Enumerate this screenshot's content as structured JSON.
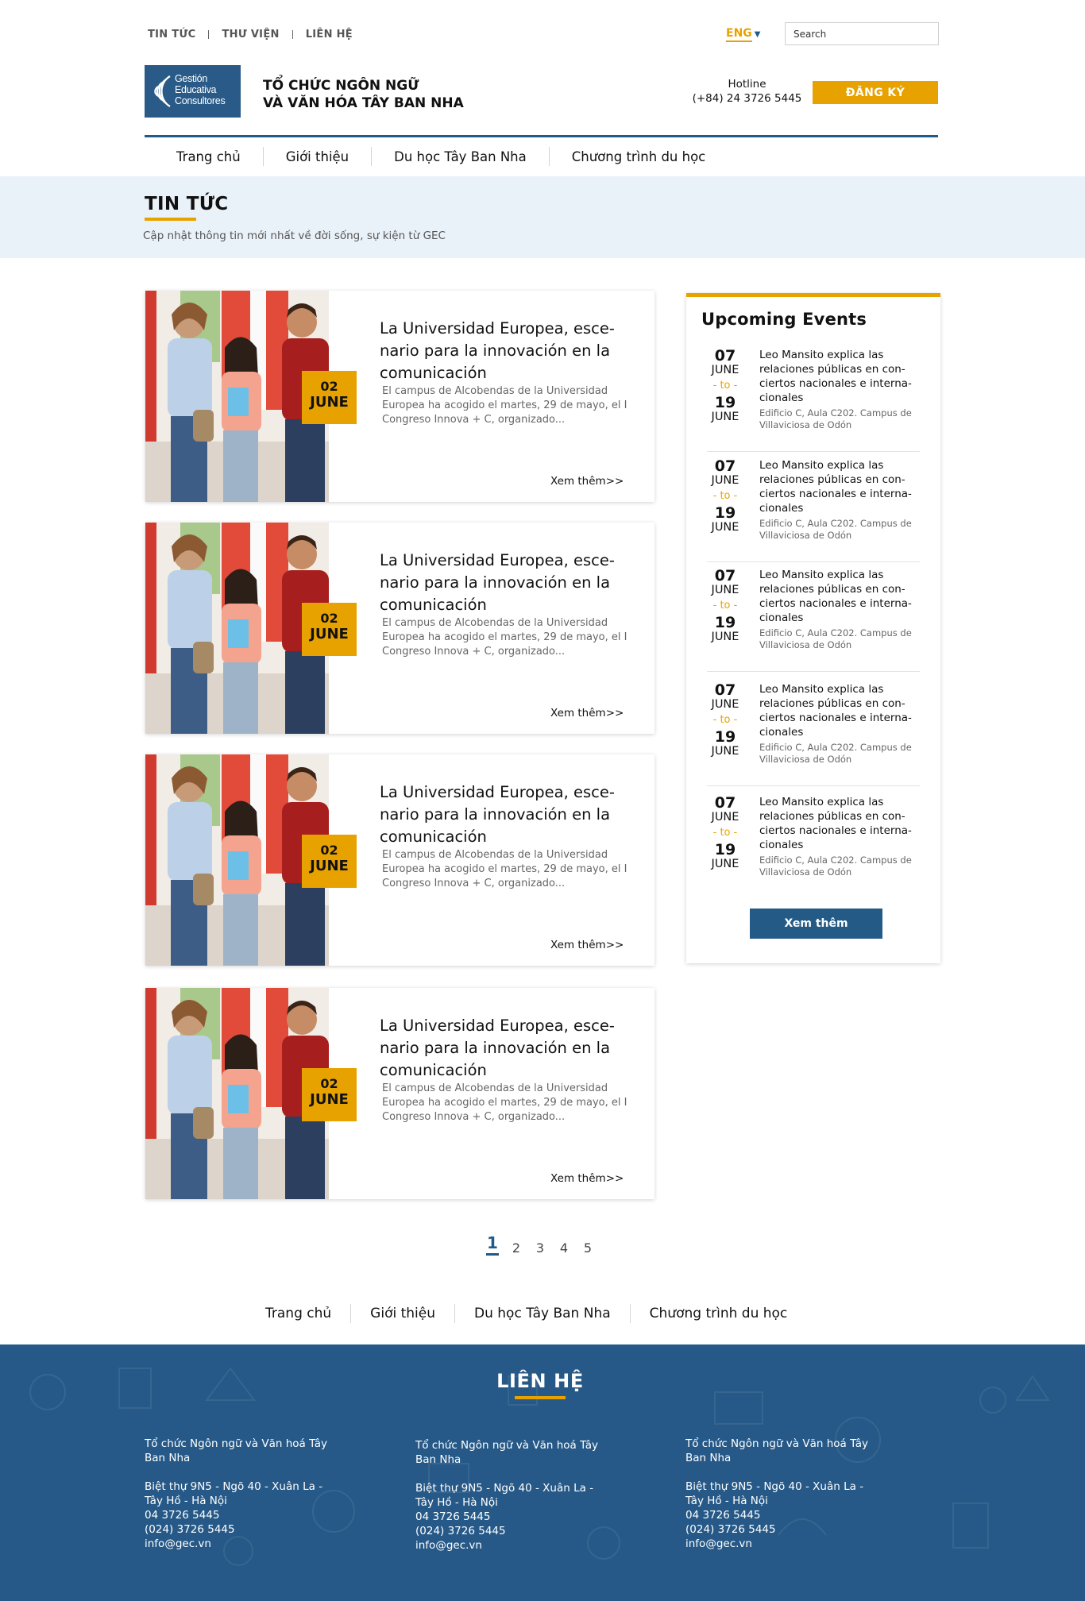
{
  "topbar": {
    "links": [
      "TIN TỨC",
      "THƯ VIỆN",
      "LIÊN HỆ"
    ],
    "language": "ENG",
    "search_placeholder": "Search"
  },
  "header": {
    "logo_lines": [
      "Gestión",
      "Educativa",
      "Consultores"
    ],
    "org_line1": "TỔ CHỨC NGÔN NGỮ",
    "org_line2": "VÀ VĂN HÓA TÂY BAN NHA",
    "hotline_label": "Hotline",
    "hotline_number": "(+84) 24 3726 5445",
    "register_label": "ĐĂNG KÝ"
  },
  "nav": [
    "Trang chủ",
    "Giới thiệu",
    "Du học Tây Ban Nha",
    "Chương trình du học"
  ],
  "banner": {
    "title": "TIN TỨC",
    "subtitle": "Cập nhật thông tin mới nhất về đời sống, sự kiện từ GEC"
  },
  "news": [
    {
      "day": "02",
      "month": "JUNE",
      "title": "La Universidad Europea, esce-nario para la innovación en la comunicación",
      "excerpt": "El campus de Alcobendas de la Universidad Europea ha acogido el martes, 29 de mayo, el I Congreso Innova + C, organizado...",
      "more": "Xem thêm>>"
    },
    {
      "day": "02",
      "month": "JUNE",
      "title": "La Universidad Europea, esce-nario para la innovación en la comunicación",
      "excerpt": "El campus de Alcobendas de la Universidad Europea ha acogido el martes, 29 de mayo, el I Congreso Innova + C, organizado...",
      "more": "Xem thêm>>"
    },
    {
      "day": "02",
      "month": "JUNE",
      "title": "La Universidad Europea, esce-nario para la innovación en la comunicación",
      "excerpt": "El campus de Alcobendas de la Universidad Europea ha acogido el martes, 29 de mayo, el I Congreso Innova + C, organizado...",
      "more": "Xem thêm>>"
    },
    {
      "day": "02",
      "month": "JUNE",
      "title": "La Universidad Europea, esce-nario para la innovación en la comunicación",
      "excerpt": "El campus de Alcobendas de la Universidad Europea ha acogido el martes, 29 de mayo, el I Congreso Innova + C, organizado...",
      "more": "Xem thêm>>"
    }
  ],
  "sidebar": {
    "title": "Upcoming Events",
    "events": [
      {
        "start_day": "07",
        "start_month": "JUNE",
        "to": "- to -",
        "end_day": "19",
        "end_month": "JUNE",
        "title": "Leo Mansito explica las relaciones públicas en con-ciertos nacionales e interna-cionales",
        "place": "Edificio C, Aula C202. Campus de Villaviciosa de Odón"
      },
      {
        "start_day": "07",
        "start_month": "JUNE",
        "to": "- to -",
        "end_day": "19",
        "end_month": "JUNE",
        "title": "Leo Mansito explica las relaciones públicas en con-ciertos nacionales e interna-cionales",
        "place": "Edificio C, Aula C202. Campus de Villaviciosa de Odón"
      },
      {
        "start_day": "07",
        "start_month": "JUNE",
        "to": "- to -",
        "end_day": "19",
        "end_month": "JUNE",
        "title": "Leo Mansito explica las relaciones públicas en con-ciertos nacionales e interna-cionales",
        "place": "Edificio C, Aula C202. Campus de Villaviciosa de Odón"
      },
      {
        "start_day": "07",
        "start_month": "JUNE",
        "to": "- to -",
        "end_day": "19",
        "end_month": "JUNE",
        "title": "Leo Mansito explica las relaciones públicas en con-ciertos nacionales e interna-cionales",
        "place": "Edificio C, Aula C202. Campus de Villaviciosa de Odón"
      },
      {
        "start_day": "07",
        "start_month": "JUNE",
        "to": "- to -",
        "end_day": "19",
        "end_month": "JUNE",
        "title": "Leo Mansito explica las relaciones públicas en con-ciertos nacionales e interna-cionales",
        "place": "Edificio C, Aula C202. Campus de Villaviciosa de Odón"
      }
    ],
    "more_label": "Xem thêm"
  },
  "pagination": [
    "1",
    "2",
    "3",
    "4",
    "5"
  ],
  "footer_nav": [
    "Trang chủ",
    "Giới thiệu",
    "Du học Tây Ban Nha",
    "Chương trình du học"
  ],
  "contact": {
    "title": "LIÊN HỆ",
    "columns": [
      {
        "org": "Tổ chức Ngôn ngữ và Văn hoá Tây Ban Nha",
        "address": "Biệt thự 9N5 - Ngõ 40 - Xuân La - Tây Hồ - Hà Nội",
        "phone": "04 3726 5445",
        "phone2": "(024) 3726 5445",
        "email": "info@gec.vn"
      },
      {
        "org": "Tổ chức Ngôn ngữ và Văn hoá Tây Ban Nha",
        "address": "Biệt thự 9N5 - Ngõ 40 - Xuân La - Tây Hồ - Hà Nội",
        "phone": "04 3726 5445",
        "phone2": "(024) 3726 5445",
        "email": "info@gec.vn"
      },
      {
        "org": "Tổ chức Ngôn ngữ và Văn hoá Tây Ban Nha",
        "address": "Biệt thự 9N5 - Ngõ 40 - Xuân La - Tây Hồ - Hà Nội",
        "phone": "04 3726 5445",
        "phone2": "(024) 3726 5445",
        "email": "info@gec.vn"
      }
    ]
  },
  "colors": {
    "accent": "#e8a200",
    "primary": "#1f5a8b",
    "banner_bg": "#eaf2f9",
    "footer_bg": "#265987"
  },
  "icons": [
    "chevron-down-icon",
    "logo-waves-icon"
  ]
}
